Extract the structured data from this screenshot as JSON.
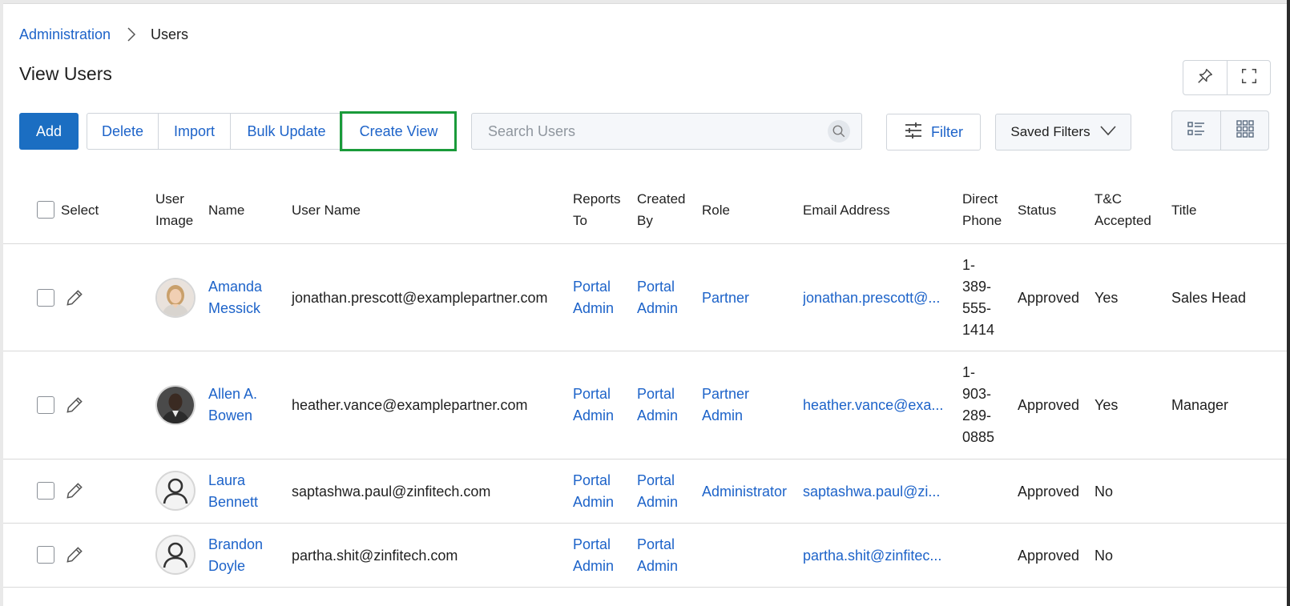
{
  "breadcrumb": {
    "parent": "Administration",
    "current": "Users"
  },
  "page_title": "View Users",
  "toolbar": {
    "add_label": "Add",
    "delete_label": "Delete",
    "import_label": "Import",
    "bulk_update_label": "Bulk Update",
    "create_view_label": "Create View",
    "search_placeholder": "Search Users",
    "filter_label": "Filter",
    "saved_filters_label": "Saved Filters"
  },
  "columns": {
    "select": "Select",
    "user_image_1": "User",
    "user_image_2": "Image",
    "name": "Name",
    "user_name": "User Name",
    "reports_to_1": "Reports",
    "reports_to_2": "To",
    "created_by_1": "Created",
    "created_by_2": "By",
    "role": "Role",
    "email": "Email Address",
    "direct_phone_1": "Direct",
    "direct_phone_2": "Phone",
    "status": "Status",
    "tc_1": "T&C",
    "tc_2": "Accepted",
    "title": "Title"
  },
  "rows": [
    {
      "name_1": "Amanda",
      "name_2": "Messick",
      "user_name": "jonathan.prescott@examplepartner.com",
      "reports_1": "Portal",
      "reports_2": "Admin",
      "created_1": "Portal",
      "created_2": "Admin",
      "role_1": "Partner",
      "role_2": "",
      "email": "jonathan.prescott@...",
      "phone": [
        "1-",
        "389-",
        "555-",
        "1414"
      ],
      "status": "Approved",
      "tc": "Yes",
      "title": "Sales Head",
      "avatar": "photo-woman"
    },
    {
      "name_1": "Allen A.",
      "name_2": "Bowen",
      "user_name": "heather.vance@examplepartner.com",
      "reports_1": "Portal",
      "reports_2": "Admin",
      "created_1": "Portal",
      "created_2": "Admin",
      "role_1": "Partner",
      "role_2": "Admin",
      "email": "heather.vance@exa...",
      "phone": [
        "1-",
        "903-",
        "289-",
        "0885"
      ],
      "status": "Approved",
      "tc": "Yes",
      "title": "Manager",
      "avatar": "photo-man"
    },
    {
      "name_1": "Laura",
      "name_2": "Bennett",
      "user_name": "saptashwa.paul@zinfitech.com",
      "reports_1": "Portal",
      "reports_2": "Admin",
      "created_1": "Portal",
      "created_2": "Admin",
      "role_1": "Administrator",
      "role_2": "",
      "email": "saptashwa.paul@zi...",
      "phone": [],
      "status": "Approved",
      "tc": "No",
      "title": "",
      "avatar": "default-user-icon"
    },
    {
      "name_1": "Brandon",
      "name_2": "Doyle",
      "user_name": "partha.shit@zinfitech.com",
      "reports_1": "Portal",
      "reports_2": "Admin",
      "created_1": "Portal",
      "created_2": "Admin",
      "role_1": "",
      "role_2": "",
      "email": "partha.shit@zinfitec...",
      "phone": [],
      "status": "Approved",
      "tc": "No",
      "title": "",
      "avatar": "default-user-icon"
    }
  ],
  "colors": {
    "primary": "#1b6ec2",
    "link": "#1d63c9",
    "highlight": "#1a9b3a"
  }
}
